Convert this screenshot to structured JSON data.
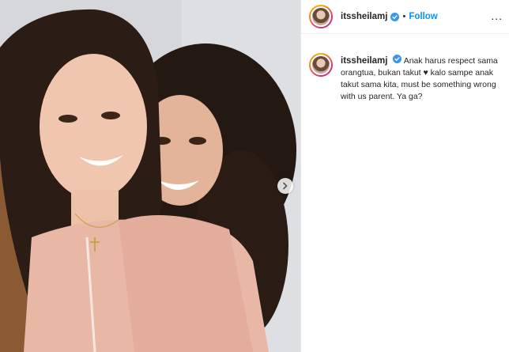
{
  "post": {
    "username": "itssheilamj",
    "follow_label": "Follow",
    "separator": "•",
    "verified_icon": "verified-badge-icon",
    "more_label": "..."
  },
  "caption": {
    "username": "itssheilamj",
    "text": "Anak harus respect sama orangtua, bukan takut ♥ kalo sampe anak takut sama kita, must be something wrong with us parent. Ya ga?"
  },
  "media": {
    "next_icon": "chevron-right-icon"
  },
  "colors": {
    "follow": "#0095f6",
    "verified": "#3897f0",
    "background": "#ffffff"
  }
}
